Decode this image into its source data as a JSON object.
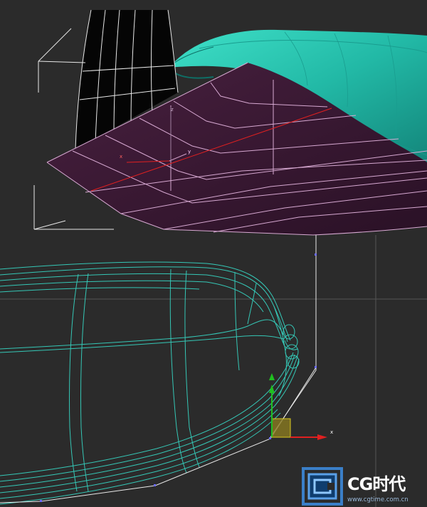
{
  "viewport": {
    "background": "#2b2b2b",
    "gizmo_top": {
      "x_label": "x",
      "y_label": "y",
      "z_label": "z"
    },
    "gizmo_bottom": {
      "x_label": "x"
    }
  },
  "colors": {
    "wire_white": "#e8e8e8",
    "shaded_teal": "#2ec4b0",
    "wire_teal": "#35c7b6",
    "purple_plane": "#3a1a33",
    "purple_edge": "#d7a9d2",
    "axis_red": "#e02020",
    "axis_green": "#20c020",
    "gizmo_yellow": "#d8c820",
    "vertex_blue": "#6a6aff"
  },
  "watermark": {
    "brand": "CG时代",
    "url": "www.cgtime.com.cn"
  }
}
